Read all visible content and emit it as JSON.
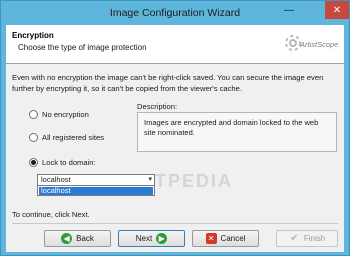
{
  "window": {
    "title": "Image Configuration Wizard",
    "minimize_glyph": "—",
    "maximize_glyph": "☐",
    "close_glyph": "✕"
  },
  "header": {
    "title": "Encryption",
    "subtitle": "Choose the type of image protection",
    "logo_text": "ArtistScope",
    "logo_icon": "artistscope-logo-icon"
  },
  "intro_text": "Even with no encryption the image can't be right-click saved. You can secure the image even further by encrypting it, so it can't be copied from the viewer's cache.",
  "options": [
    {
      "label": "No encryption",
      "selected": false
    },
    {
      "label": "All registered sites",
      "selected": false
    },
    {
      "label": "Lock to domain:",
      "selected": true
    }
  ],
  "description": {
    "label": "Description:",
    "text": "Images are encrypted and domain locked to the web site nominated."
  },
  "domain_select": {
    "value": "localhost",
    "options": [
      "localhost"
    ],
    "arrow_glyph": "▾"
  },
  "watermark_text": "SOFTPEDIA",
  "footer_note": "To continue, click Next.",
  "buttons": {
    "back": "Back",
    "next": "Next",
    "cancel": "Cancel",
    "finish": "Finish"
  },
  "colors": {
    "titlebar": "#5eb6dc",
    "close_button": "#c7483f",
    "selection": "#2a7ad6",
    "nav_icon": "#2f9e3a",
    "cancel_icon": "#d13a2a"
  }
}
